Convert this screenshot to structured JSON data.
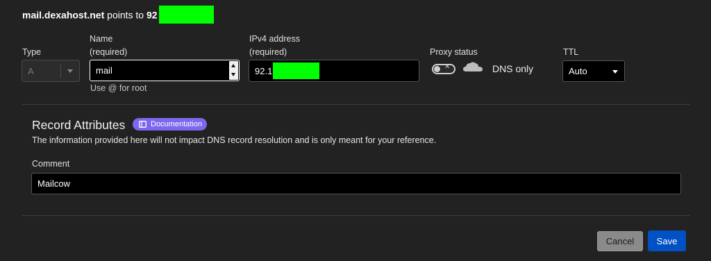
{
  "heading": {
    "host": "mail.dexahost.net",
    "points_to": "points to",
    "ip_prefix": "92"
  },
  "type_field": {
    "label": "Type",
    "value": "A"
  },
  "name_field": {
    "label_line1": "Name",
    "label_line2": "(required)",
    "value": "mail",
    "hint": "Use @ for root"
  },
  "ipv4_field": {
    "label_line1": "IPv4 address",
    "label_line2": "(required)",
    "value_prefix": "92.1"
  },
  "proxy": {
    "label": "Proxy status",
    "status_text": "DNS only",
    "icon": "cloud-icon"
  },
  "ttl_field": {
    "label": "TTL",
    "value": "Auto"
  },
  "record_attributes": {
    "title": "Record Attributes",
    "doc_badge": "Documentation",
    "description": "The information provided here will not impact DNS record resolution and is only meant for your reference."
  },
  "comment_field": {
    "label": "Comment",
    "value": "Mailcow"
  },
  "buttons": {
    "cancel": "Cancel",
    "save": "Save"
  },
  "colors": {
    "accent": "#0051c3",
    "badge": "#7b68ee",
    "redaction": "#00ff00"
  }
}
